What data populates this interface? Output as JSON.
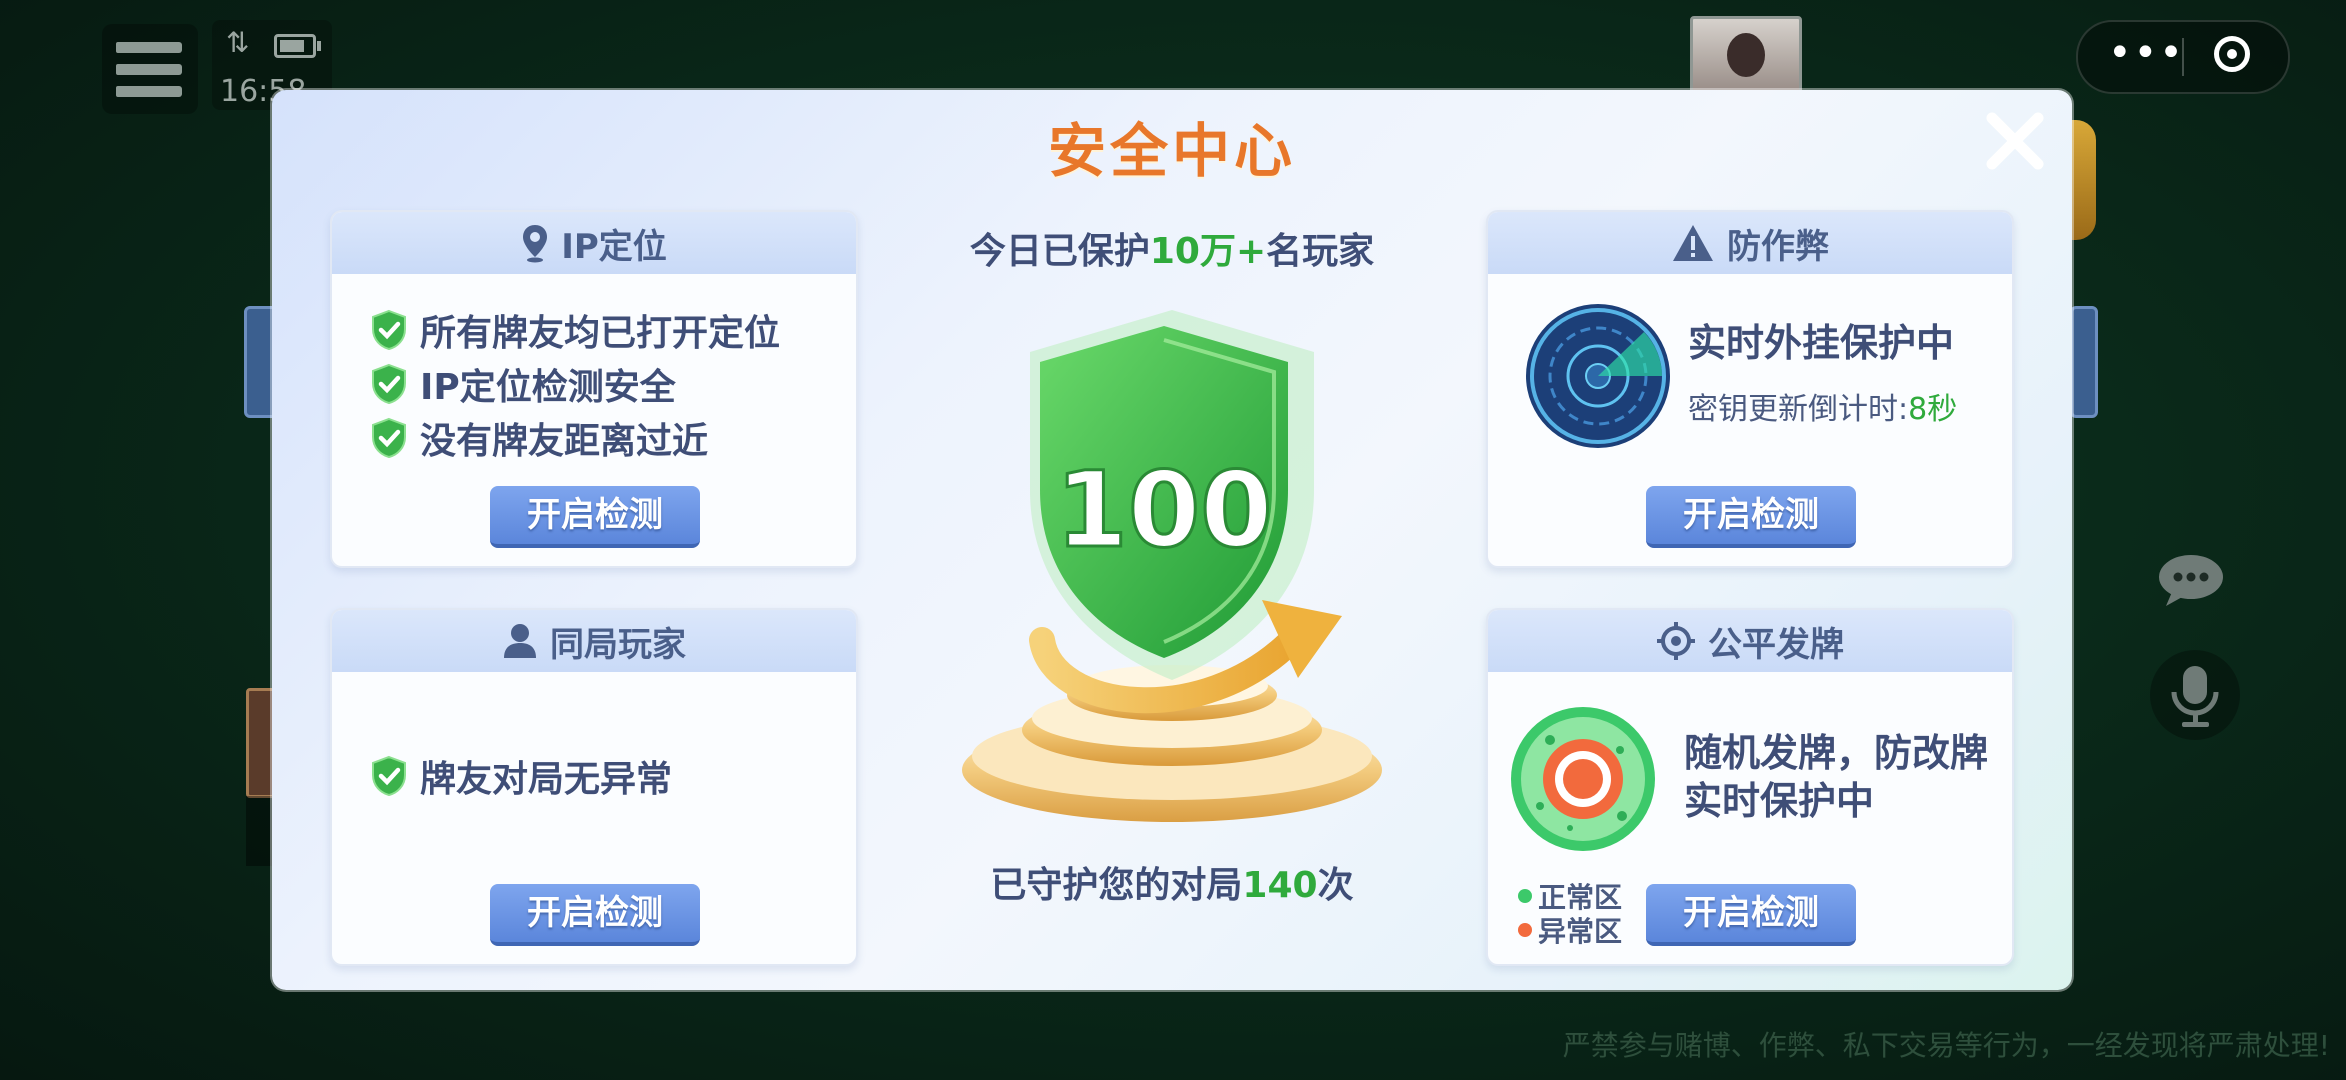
{
  "status_bar": {
    "time": "16:58"
  },
  "dialog": {
    "title": "安全中心",
    "panels": {
      "ip": {
        "title": "IP定位",
        "items": [
          "所有牌友均已打开定位",
          "IP定位检测安全",
          "没有牌友距离过近"
        ],
        "button": "开启检测"
      },
      "same_game": {
        "title": "同局玩家",
        "items": [
          "牌友对局无异常"
        ],
        "button": "开启检测"
      },
      "anti_cheat": {
        "title": "防作弊",
        "status": "实时外挂保护中",
        "countdown_label": "密钥更新倒计时:",
        "countdown_value": "8秒",
        "button": "开启检测"
      },
      "fair_deal": {
        "title": "公平发牌",
        "line1": "随机发牌，防改牌",
        "line2": "实时保护中",
        "legend_normal": "正常区",
        "legend_abnormal": "异常区",
        "button": "开启检测"
      }
    },
    "center": {
      "protect_prefix": "今日已保护",
      "protect_count": "10万+",
      "protect_suffix": "名玩家",
      "score": "100",
      "guard_prefix": "已守护您的对局",
      "guard_count": "140",
      "guard_suffix": "次"
    }
  },
  "footer_warning": "严禁参与赌博、作弊、私下交易等行为，一经发现将严肃处理!",
  "colors": {
    "title": "#e8772a",
    "highlight_green": "#2faa3c",
    "button_blue": "#5b86db",
    "text_dark": "#3f4e77"
  }
}
